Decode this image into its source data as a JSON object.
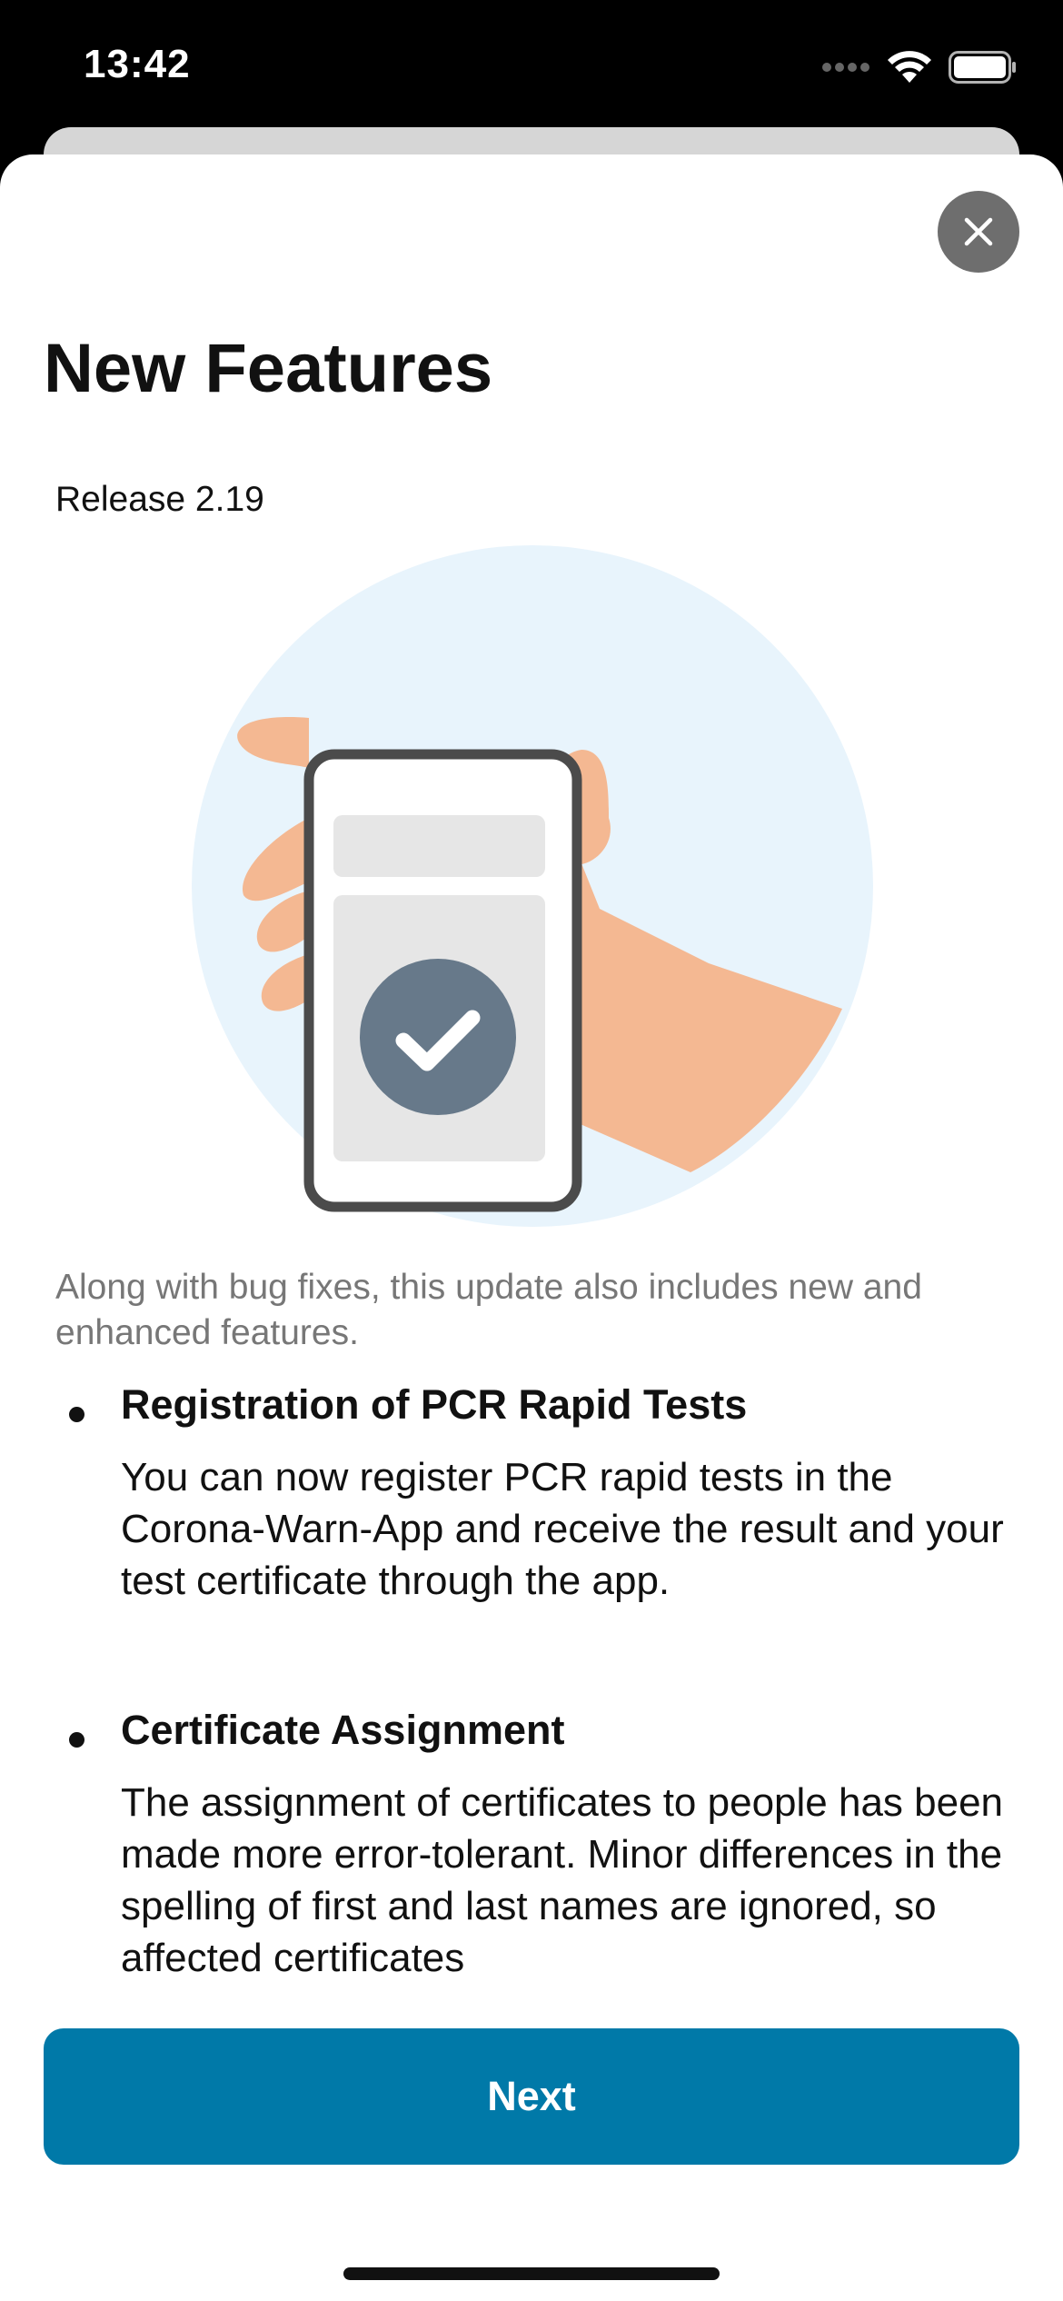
{
  "status_bar": {
    "time": "13:42"
  },
  "header": {
    "title": "New Features",
    "release": "Release 2.19"
  },
  "intro": "Along with bug fixes, this update also includes new and enhanced features.",
  "features": [
    {
      "title": "Registration of PCR Rapid Tests",
      "body": "You can now register PCR rapid tests in the Corona-Warn-App and receive the result and your test certificate through the app."
    },
    {
      "title": "Certificate Assignment",
      "body": "The assignment of certificates to people has been made more error-tolerant. Minor differences in the spelling of first and last names are ignored, so affected certificates"
    }
  ],
  "buttons": {
    "next_label": "Next"
  },
  "icons": {
    "close": "close-icon",
    "illustration": "phone-in-hand-illustration",
    "wifi": "wifi-icon",
    "battery": "battery-icon",
    "signal": "cellular-signal-icon"
  },
  "colors": {
    "accent": "#0079a8",
    "illustration_bg": "#e8f4fc",
    "skin": "#f4b892",
    "check_badge": "#67798a"
  }
}
